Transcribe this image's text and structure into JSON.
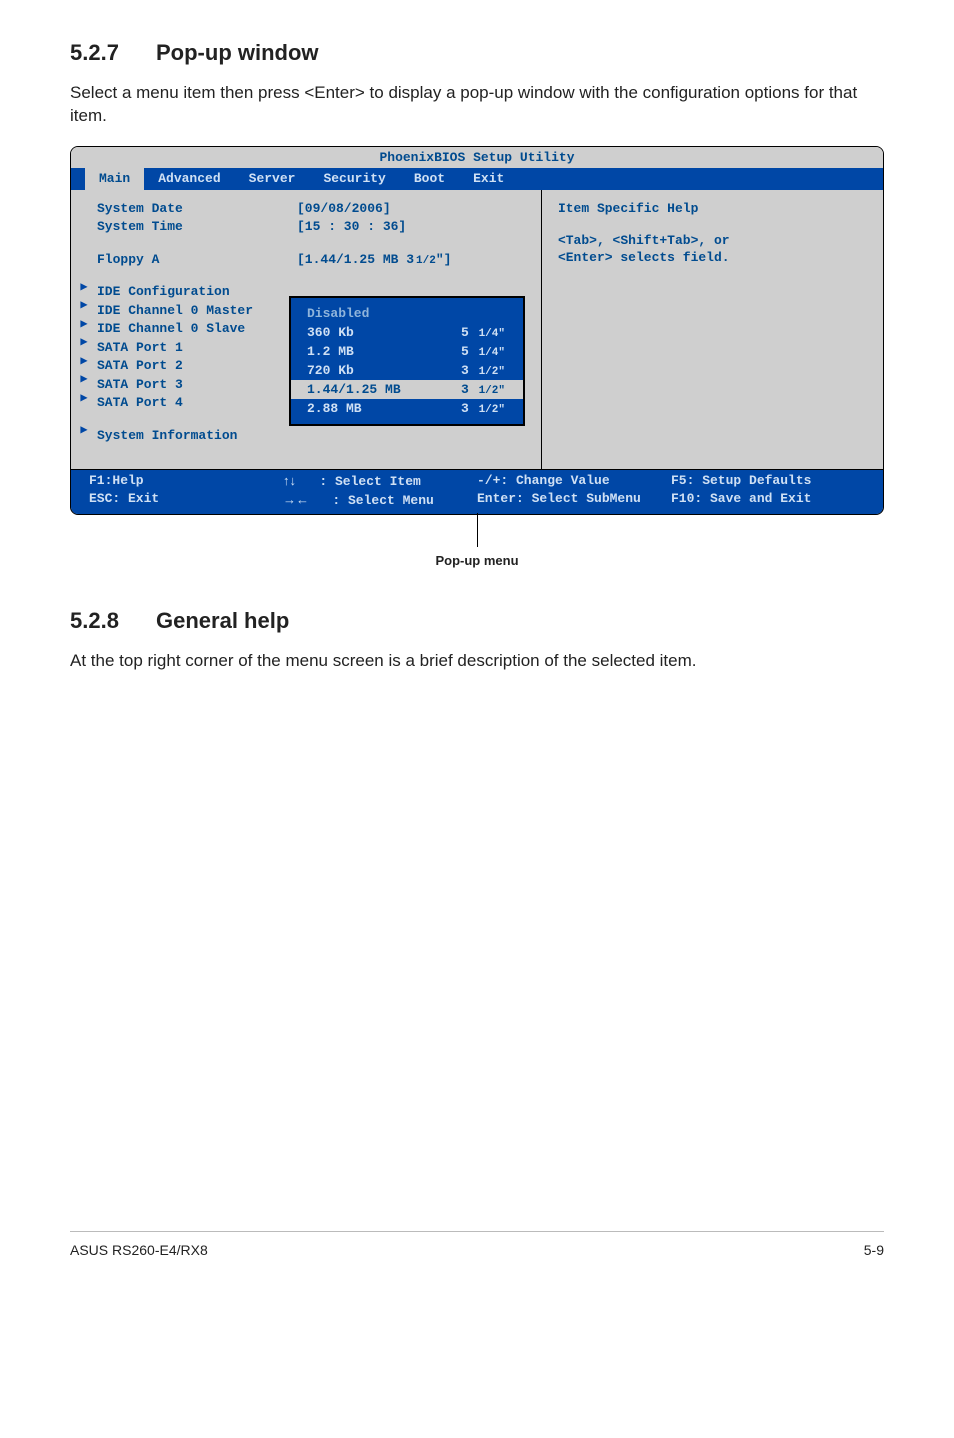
{
  "section_popup": {
    "number": "5.2.7",
    "title": "Pop-up window",
    "text": "Select a menu item then press <Enter> to display a pop-up window with the configuration options for that item."
  },
  "section_help": {
    "number": "5.2.8",
    "title": "General help",
    "text": "At the top right corner of the menu screen is a brief description of the selected item."
  },
  "bios": {
    "util_title": "PhoenixBIOS Setup Utility",
    "tabs": [
      "Main",
      "Advanced",
      "Server",
      "Security",
      "Boot",
      "Exit"
    ],
    "active_tab": "Main",
    "fields": {
      "system_date_label": "System Date",
      "system_date_value": "[09/08/2006]",
      "system_time_label": "System Time",
      "system_time_value": "[15 : 30 : 36]",
      "floppy_label": "Floppy A",
      "floppy_value": "[1.44/1.25 MB 3",
      "floppy_value_frac": "1/2",
      "floppy_value_tail": "\"]"
    },
    "items": [
      "IDE Configuration",
      "IDE Channel 0 Master",
      "IDE Channel 0 Slave",
      "SATA Port 1",
      "SATA Port 2",
      "SATA Port 3",
      "SATA Port 4",
      "System Information"
    ],
    "help": {
      "title": "Item Specific Help",
      "line1": "<Tab>, <Shift+Tab>, or",
      "line2": "<Enter> selects field."
    },
    "popup": [
      {
        "l": "Disabled",
        "r": "",
        "cls": "disabled"
      },
      {
        "l": "360 Kb",
        "r_pre": "5",
        "r_frac": "1/4",
        "r_post": "\"",
        "cls": ""
      },
      {
        "l": "1.2 MB",
        "r_pre": "5",
        "r_frac": "1/4",
        "r_post": "\"",
        "cls": ""
      },
      {
        "l": "720 Kb",
        "r_pre": "3",
        "r_frac": "1/2",
        "r_post": "\"",
        "cls": ""
      },
      {
        "l": "1.44/1.25 MB",
        "r_pre": "3",
        "r_frac": "1/2",
        "r_post": "\"",
        "cls": "hl"
      },
      {
        "l": "2.88 MB",
        "r_pre": "3",
        "r_frac": "1/2",
        "r_post": "\"",
        "cls": ""
      }
    ],
    "footer": {
      "c1a": "F1:Help",
      "c1b": "ESC: Exit",
      "c2a": ": Select Item",
      "c2b": ": Select Menu",
      "c3a": "-/+: Change Value",
      "c3b": "Enter: Select SubMenu",
      "c4a": "F5: Setup Defaults",
      "c4b": "F10: Save and Exit"
    }
  },
  "pointer_label": "Pop-up menu",
  "page_footer_left": "ASUS RS260-E4/RX8",
  "page_footer_right": "5-9"
}
